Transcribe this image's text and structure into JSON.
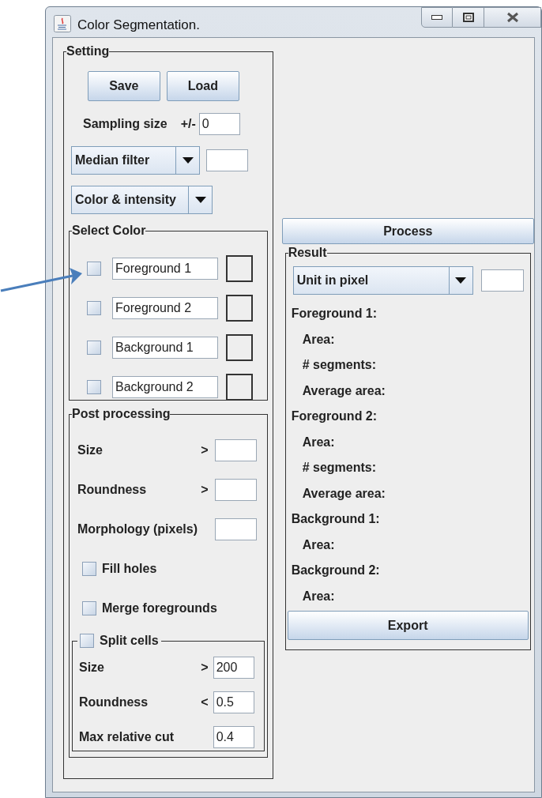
{
  "window": {
    "title": "Color Segmentation."
  },
  "setting": {
    "title": "Setting",
    "buttons": [
      "Save",
      "Load"
    ],
    "sampling": {
      "label": "Sampling size",
      "sign": "+/-",
      "value": "0"
    },
    "filter_select": {
      "value": "Median filter"
    },
    "mode_select": {
      "value": "Color & intensity"
    },
    "select_color": {
      "title": "Select Color",
      "rows": [
        {
          "label": "Foreground 1",
          "checked": false
        },
        {
          "label": "Foreground 2",
          "checked": false
        },
        {
          "label": "Background 1",
          "checked": false
        },
        {
          "label": "Background 2",
          "checked": false
        }
      ]
    },
    "post_processing": {
      "title": "Post processing",
      "fields": [
        {
          "label": "Size",
          "op": ">"
        },
        {
          "label": "Roundness",
          "op": ">"
        },
        {
          "label": "Morphology (pixels)"
        }
      ],
      "options": [
        {
          "label": "Fill holes",
          "checked": false
        },
        {
          "label": "Merge foregrounds",
          "checked": false
        }
      ],
      "split_cells": {
        "label": "Split cells",
        "checked": false,
        "fields": [
          {
            "label": "Size",
            "op": ">",
            "value": "200"
          },
          {
            "label": "Roundness",
            "op": "<",
            "value": "0.5"
          },
          {
            "label": "Max relative cut",
            "value": "0.4"
          }
        ]
      }
    }
  },
  "process_button": "Process",
  "result": {
    "title": "Result",
    "unit_select": {
      "value": "Unit in pixel"
    },
    "groups": [
      {
        "title": "Foreground 1:",
        "items": [
          "Area:",
          "# segments:",
          "Average area:"
        ]
      },
      {
        "title": "Foreground 2:",
        "items": [
          "Area:",
          "# segments:",
          "Average area:"
        ]
      },
      {
        "title": "Background 1:",
        "items": [
          "Area:"
        ]
      },
      {
        "title": "Background 2:",
        "items": [
          "Area:"
        ]
      }
    ],
    "export_button": "Export"
  }
}
